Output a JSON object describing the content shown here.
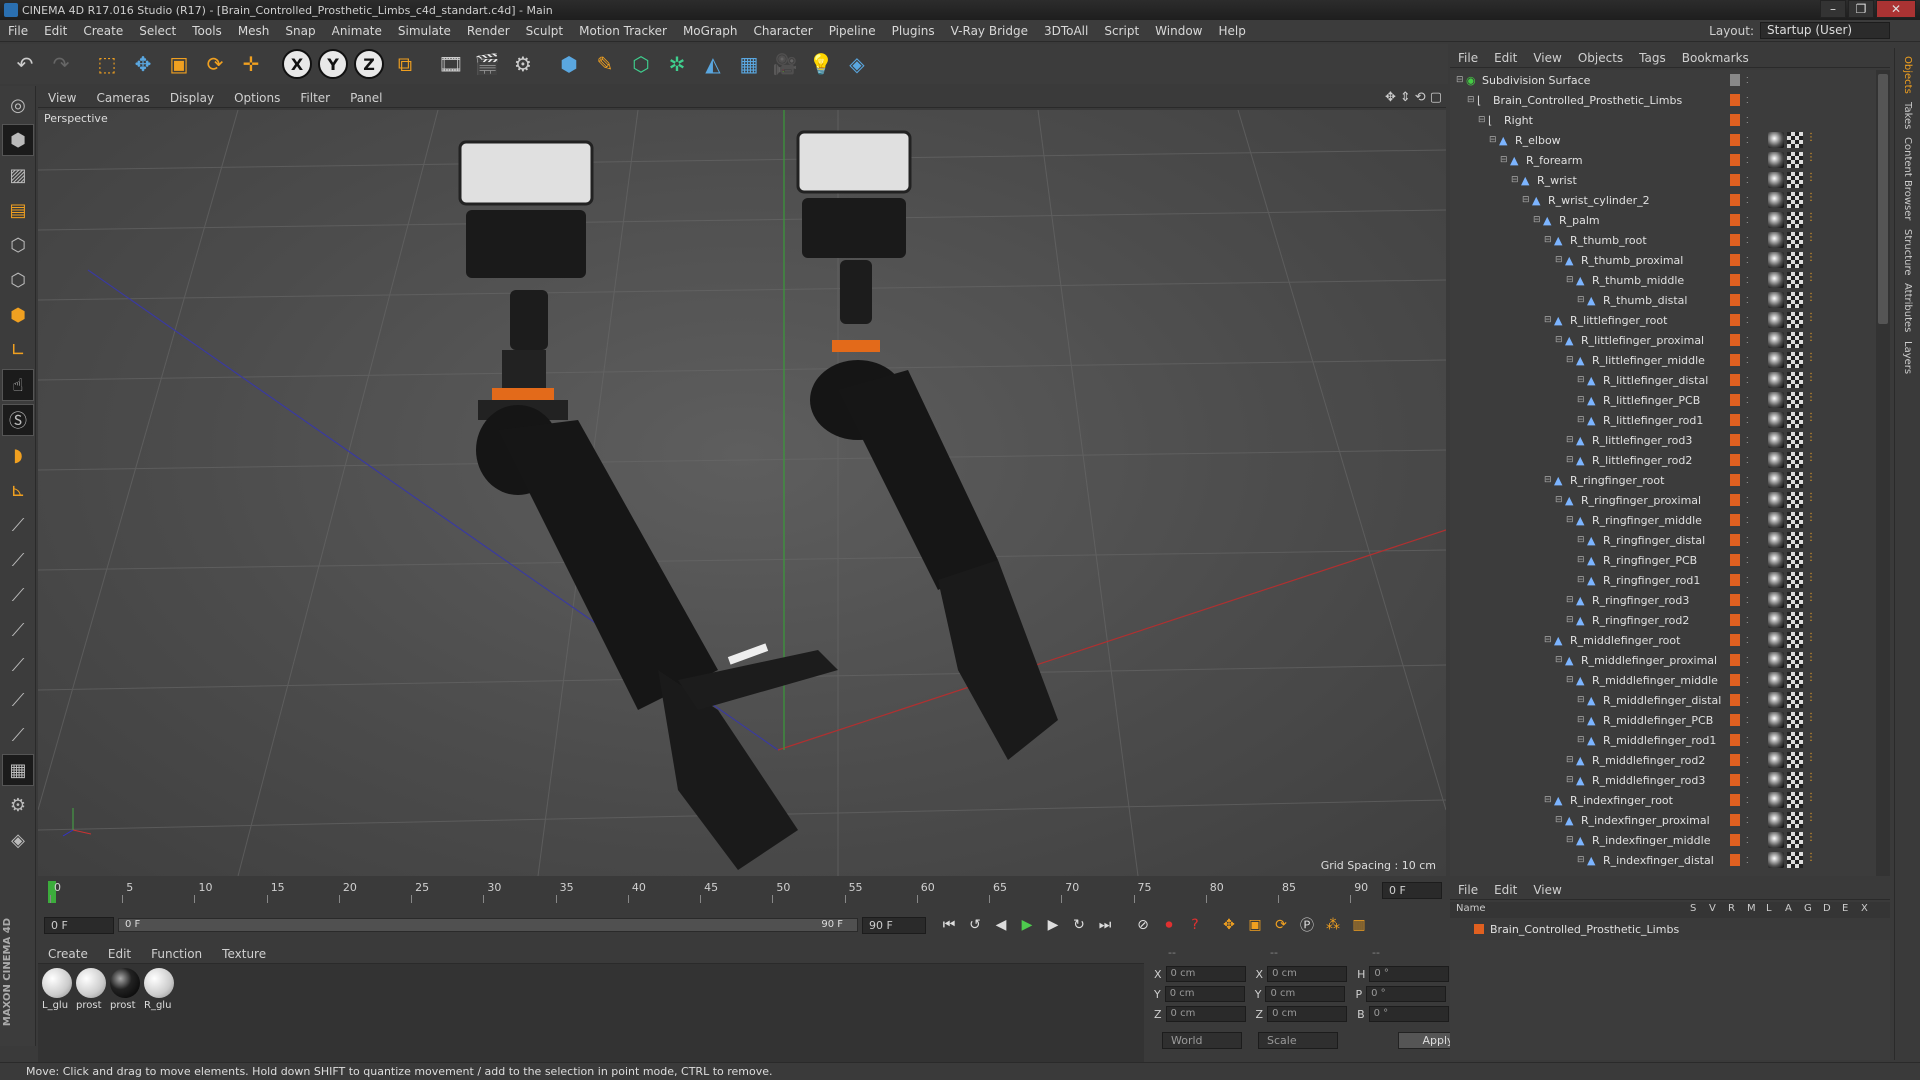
{
  "window": {
    "title": "CINEMA 4D R17.016 Studio (R17) - [Brain_Controlled_Prosthetic_Limbs_c4d_standart.c4d] - Main"
  },
  "menu": [
    "File",
    "Edit",
    "Create",
    "Select",
    "Tools",
    "Mesh",
    "Snap",
    "Animate",
    "Simulate",
    "Render",
    "Sculpt",
    "Motion Tracker",
    "MoGraph",
    "Character",
    "Pipeline",
    "Plugins",
    "V-Ray Bridge",
    "3DToAll",
    "Script",
    "Window",
    "Help"
  ],
  "layout": {
    "label": "Layout:",
    "value": "Startup (User)"
  },
  "toolbar": {
    "x": "X",
    "y": "Y",
    "z": "Z"
  },
  "viewport": {
    "menu": [
      "View",
      "Cameras",
      "Display",
      "Options",
      "Filter",
      "Panel"
    ],
    "camera": "Perspective",
    "grid_spacing": "Grid Spacing : 10 cm"
  },
  "timeline": {
    "ticks": [
      "0",
      "5",
      "10",
      "15",
      "20",
      "25",
      "30",
      "35",
      "40",
      "45",
      "50",
      "55",
      "60",
      "65",
      "70",
      "75",
      "80",
      "85",
      "90"
    ],
    "current_frame": "0 F",
    "start": "0 F",
    "range_start": "0 F",
    "range_end": "90 F",
    "end": "90 F"
  },
  "materials": {
    "menu": [
      "Create",
      "Edit",
      "Function",
      "Texture"
    ],
    "items": [
      {
        "name": "L_glu",
        "dark": false
      },
      {
        "name": "prost",
        "dark": false
      },
      {
        "name": "prost",
        "dark": true
      },
      {
        "name": "R_glu",
        "dark": false
      }
    ]
  },
  "coords": {
    "headers": [
      "--",
      "--",
      "--"
    ],
    "rows": [
      {
        "a": "X",
        "av": "0 cm",
        "b": "X",
        "bv": "0 cm",
        "c": "H",
        "cv": "0 °"
      },
      {
        "a": "Y",
        "av": "0 cm",
        "b": "Y",
        "bv": "0 cm",
        "c": "P",
        "cv": "0 °"
      },
      {
        "a": "Z",
        "av": "0 cm",
        "b": "Z",
        "bv": "0 cm",
        "c": "B",
        "cv": "0 °"
      }
    ],
    "space": "World",
    "mode": "Scale",
    "apply": "Apply"
  },
  "objects": {
    "menu": [
      "File",
      "Edit",
      "View",
      "Objects",
      "Tags",
      "Bookmarks"
    ],
    "rows": [
      {
        "name": "Subdivision Surface",
        "level": 0,
        "icon": "green",
        "tags": false
      },
      {
        "name": "Brain_Controlled_Prosthetic_Limbs",
        "level": 1,
        "icon": "null",
        "tags": false
      },
      {
        "name": "Right",
        "level": 2,
        "icon": "null",
        "tags": false
      },
      {
        "name": "R_elbow",
        "level": 3,
        "icon": "bone",
        "tags": true
      },
      {
        "name": "R_forearm",
        "level": 4,
        "icon": "bone",
        "tags": true
      },
      {
        "name": "R_wrist",
        "level": 5,
        "icon": "bone",
        "tags": true
      },
      {
        "name": "R_wrist_cylinder_2",
        "level": 6,
        "icon": "bone",
        "tags": true
      },
      {
        "name": "R_palm",
        "level": 7,
        "icon": "bone",
        "tags": true
      },
      {
        "name": "R_thumb_root",
        "level": 8,
        "icon": "bone",
        "tags": true
      },
      {
        "name": "R_thumb_proximal",
        "level": 9,
        "icon": "bone",
        "tags": true
      },
      {
        "name": "R_thumb_middle",
        "level": 10,
        "icon": "bone",
        "tags": true
      },
      {
        "name": "R_thumb_distal",
        "level": 11,
        "icon": "bone",
        "tags": true
      },
      {
        "name": "R_littlefinger_root",
        "level": 8,
        "icon": "bone",
        "tags": true
      },
      {
        "name": "R_littlefinger_proximal",
        "level": 9,
        "icon": "bone",
        "tags": true
      },
      {
        "name": "R_littlefinger_middle",
        "level": 10,
        "icon": "bone",
        "tags": true
      },
      {
        "name": "R_littlefinger_distal",
        "level": 11,
        "icon": "bone",
        "tags": true
      },
      {
        "name": "R_littlefinger_PCB",
        "level": 11,
        "icon": "bone",
        "tags": true
      },
      {
        "name": "R_littlefinger_rod1",
        "level": 11,
        "icon": "bone",
        "tags": true
      },
      {
        "name": "R_littlefinger_rod3",
        "level": 10,
        "icon": "bone",
        "tags": true
      },
      {
        "name": "R_littlefinger_rod2",
        "level": 10,
        "icon": "bone",
        "tags": true
      },
      {
        "name": "R_ringfinger_root",
        "level": 8,
        "icon": "bone",
        "tags": true
      },
      {
        "name": "R_ringfinger_proximal",
        "level": 9,
        "icon": "bone",
        "tags": true
      },
      {
        "name": "R_ringfinger_middle",
        "level": 10,
        "icon": "bone",
        "tags": true
      },
      {
        "name": "R_ringfinger_distal",
        "level": 11,
        "icon": "bone",
        "tags": true
      },
      {
        "name": "R_ringfinger_PCB",
        "level": 11,
        "icon": "bone",
        "tags": true
      },
      {
        "name": "R_ringfinger_rod1",
        "level": 11,
        "icon": "bone",
        "tags": true
      },
      {
        "name": "R_ringfinger_rod3",
        "level": 10,
        "icon": "bone",
        "tags": true
      },
      {
        "name": "R_ringfinger_rod2",
        "level": 10,
        "icon": "bone",
        "tags": true
      },
      {
        "name": "R_middlefinger_root",
        "level": 8,
        "icon": "bone",
        "tags": true
      },
      {
        "name": "R_middlefinger_proximal",
        "level": 9,
        "icon": "bone",
        "tags": true
      },
      {
        "name": "R_middlefinger_middle",
        "level": 10,
        "icon": "bone",
        "tags": true
      },
      {
        "name": "R_middlefinger_distal",
        "level": 11,
        "icon": "bone",
        "tags": true
      },
      {
        "name": "R_middlefinger_PCB",
        "level": 11,
        "icon": "bone",
        "tags": true
      },
      {
        "name": "R_middlefinger_rod1",
        "level": 11,
        "icon": "bone",
        "tags": true
      },
      {
        "name": "R_middlefinger_rod2",
        "level": 10,
        "icon": "bone",
        "tags": true
      },
      {
        "name": "R_middlefinger_rod3",
        "level": 10,
        "icon": "bone",
        "tags": true
      },
      {
        "name": "R_indexfinger_root",
        "level": 8,
        "icon": "bone",
        "tags": true
      },
      {
        "name": "R_indexfinger_proximal",
        "level": 9,
        "icon": "bone",
        "tags": true
      },
      {
        "name": "R_indexfinger_middle",
        "level": 10,
        "icon": "bone",
        "tags": true
      },
      {
        "name": "R_indexfinger_distal",
        "level": 11,
        "icon": "bone",
        "tags": true
      }
    ]
  },
  "layers": {
    "menu": [
      "File",
      "Edit",
      "View"
    ],
    "columns": [
      "Name",
      "S",
      "V",
      "R",
      "M",
      "L",
      "A",
      "G",
      "D",
      "E",
      "X"
    ],
    "row": "Brain_Controlled_Prosthetic_Limbs"
  },
  "right_tabs": [
    "Objects",
    "Takes",
    "Content Browser",
    "Structure",
    "Attributes",
    "Layers"
  ],
  "brand": "MAXON CINEMA 4D",
  "status": "Move: Click and drag to move elements. Hold down SHIFT to quantize movement / add to the selection in point mode, CTRL to remove.",
  "colors": {
    "accent": "#f0a020",
    "tag": "#e06020",
    "bone": "#7cb4ff",
    "play": "#4ecb4e"
  }
}
